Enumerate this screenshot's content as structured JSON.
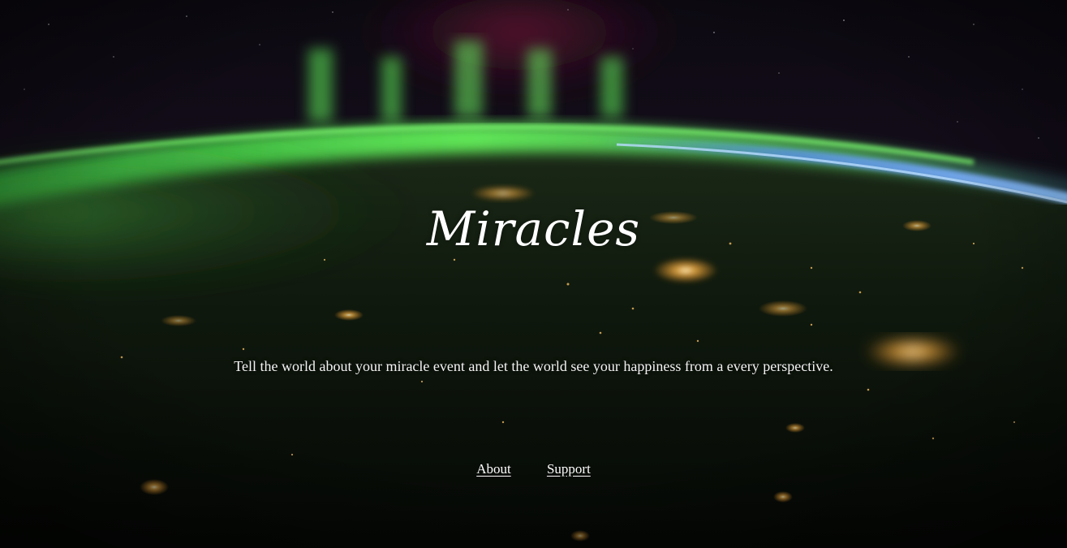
{
  "site": {
    "title": "Miracles",
    "tagline": "Tell the world about your miracle event and let the world see your happiness from a every perspective."
  },
  "nav": {
    "items": [
      {
        "label": "About"
      },
      {
        "label": "Support"
      }
    ]
  },
  "theme": {
    "text_color": "#ffffff",
    "aurora_green": "#4cdf4c",
    "atmosphere_blue": "#6fa8ff",
    "city_light": "#ffb84a",
    "space_black": "#050806"
  }
}
